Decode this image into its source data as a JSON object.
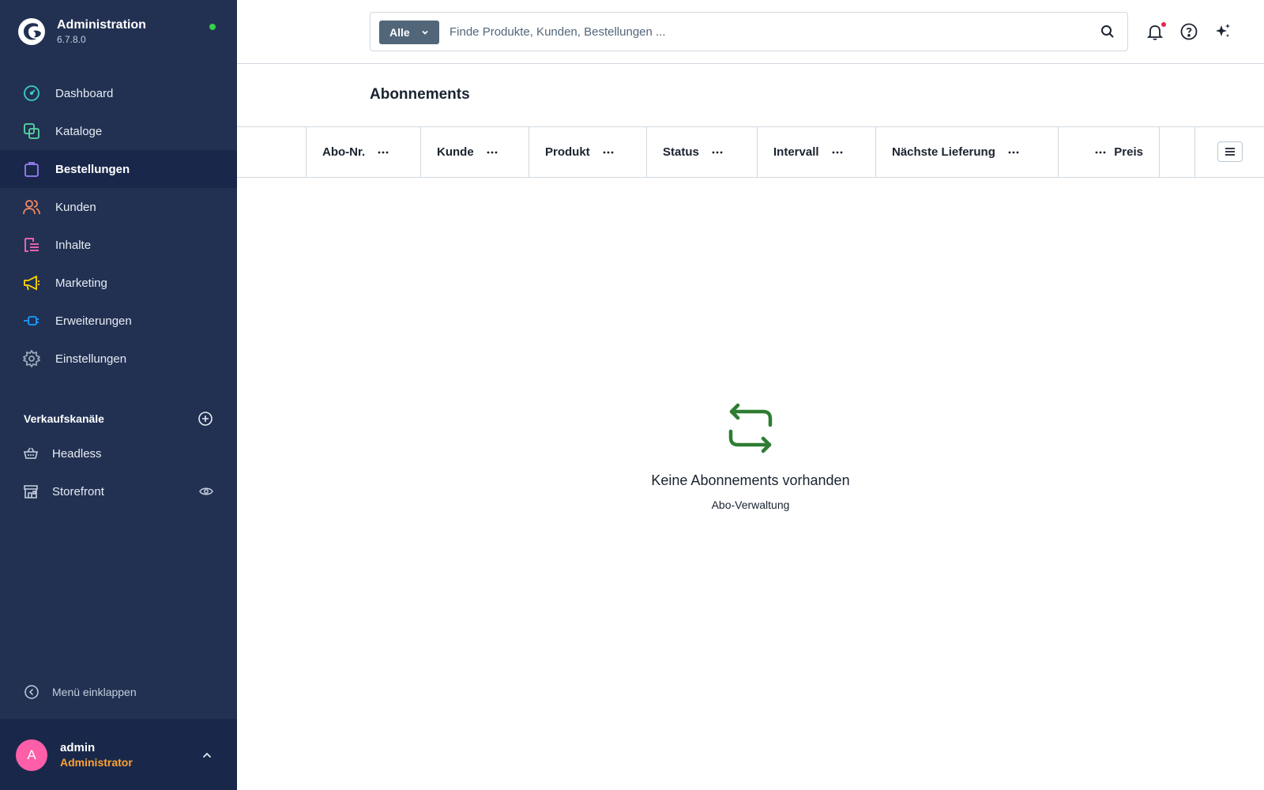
{
  "app": {
    "title": "Administration",
    "version": "6.7.8.0",
    "status": "online"
  },
  "nav": [
    {
      "label": "Dashboard",
      "icon": "dashboard-icon",
      "color": "#3ad0c0"
    },
    {
      "label": "Kataloge",
      "icon": "catalog-icon",
      "color": "#57d9a3"
    },
    {
      "label": "Bestellungen",
      "icon": "shopping-bag-icon",
      "color": "#9a7ff5",
      "active": true
    },
    {
      "label": "Kunden",
      "icon": "users-icon",
      "color": "#f88962"
    },
    {
      "label": "Inhalte",
      "icon": "content-icon",
      "color": "#ff68b4"
    },
    {
      "label": "Marketing",
      "icon": "megaphone-icon",
      "color": "#ffd700"
    },
    {
      "label": "Erweiterungen",
      "icon": "plug-icon",
      "color": "#189eff"
    },
    {
      "label": "Einstellungen",
      "icon": "gear-icon",
      "color": "#9aa8b5"
    }
  ],
  "sales_channels": {
    "title": "Verkaufskanäle",
    "items": [
      {
        "label": "Headless",
        "icon": "basket-icon"
      },
      {
        "label": "Storefront",
        "icon": "storefront-icon",
        "preview": true
      }
    ]
  },
  "collapse_label": "Menü einklappen",
  "user": {
    "initial": "A",
    "name": "admin",
    "role": "Administrator",
    "avatar_color": "#ff5ea8"
  },
  "search": {
    "type_label": "Alle",
    "placeholder": "Finde Produkte, Kunden, Bestellungen ..."
  },
  "page": {
    "title": "Abonnements"
  },
  "grid": {
    "columns": [
      {
        "label": "Abo-Nr."
      },
      {
        "label": "Kunde"
      },
      {
        "label": "Produkt"
      },
      {
        "label": "Status"
      },
      {
        "label": "Intervall"
      },
      {
        "label": "Nächste Lieferung"
      },
      {
        "label": "Preis"
      }
    ]
  },
  "empty_state": {
    "title": "Keine Abonnements vorhanden",
    "subtitle": "Abo-Verwaltung",
    "icon": "repeat-icon",
    "icon_color": "#2e7d32"
  }
}
